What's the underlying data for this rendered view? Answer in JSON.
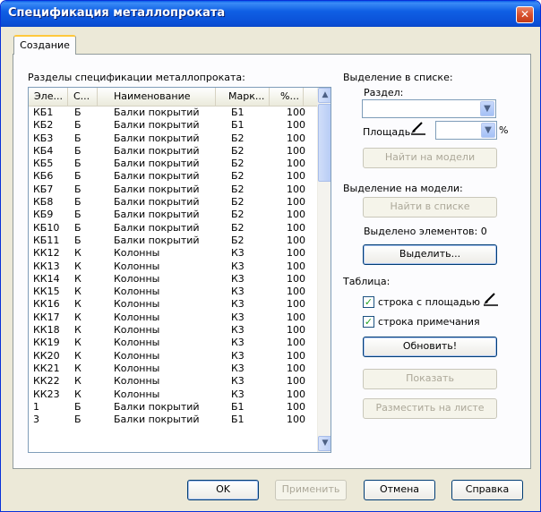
{
  "window": {
    "title": "Спецификация металлопроката",
    "close_glyph": "✕"
  },
  "tabs": [
    {
      "label": "Создание",
      "active": true
    }
  ],
  "list": {
    "label": "Разделы спецификации металлопроката:",
    "columns": [
      "Эле...",
      "С...",
      "Наименование",
      "Марк...",
      "%..."
    ],
    "rows": [
      [
        "КБ1",
        "Б",
        "Балки покрытий",
        "Б1",
        "100"
      ],
      [
        "КБ2",
        "Б",
        "Балки покрытий",
        "Б1",
        "100"
      ],
      [
        "КБ3",
        "Б",
        "Балки покрытий",
        "Б2",
        "100"
      ],
      [
        "КБ4",
        "Б",
        "Балки покрытий",
        "Б2",
        "100"
      ],
      [
        "КБ5",
        "Б",
        "Балки покрытий",
        "Б2",
        "100"
      ],
      [
        "КБ6",
        "Б",
        "Балки покрытий",
        "Б2",
        "100"
      ],
      [
        "КБ7",
        "Б",
        "Балки покрытий",
        "Б2",
        "100"
      ],
      [
        "КБ8",
        "Б",
        "Балки покрытий",
        "Б2",
        "100"
      ],
      [
        "КБ9",
        "Б",
        "Балки покрытий",
        "Б2",
        "100"
      ],
      [
        "КБ10",
        "Б",
        "Балки покрытий",
        "Б2",
        "100"
      ],
      [
        "КБ11",
        "Б",
        "Балки покрытий",
        "Б2",
        "100"
      ],
      [
        "КК12",
        "К",
        "Колонны",
        "К3",
        "100"
      ],
      [
        "КК13",
        "К",
        "Колонны",
        "К3",
        "100"
      ],
      [
        "КК14",
        "К",
        "Колонны",
        "К3",
        "100"
      ],
      [
        "КК15",
        "К",
        "Колонны",
        "К3",
        "100"
      ],
      [
        "КК16",
        "К",
        "Колонны",
        "К3",
        "100"
      ],
      [
        "КК17",
        "К",
        "Колонны",
        "К3",
        "100"
      ],
      [
        "КК18",
        "К",
        "Колонны",
        "К3",
        "100"
      ],
      [
        "КК19",
        "К",
        "Колонны",
        "К3",
        "100"
      ],
      [
        "КК20",
        "К",
        "Колонны",
        "К3",
        "100"
      ],
      [
        "КК21",
        "К",
        "Колонны",
        "К3",
        "100"
      ],
      [
        "КК22",
        "К",
        "Колонны",
        "К3",
        "100"
      ],
      [
        "КК23",
        "К",
        "Колонны",
        "К3",
        "100"
      ],
      [
        "1",
        "Б",
        "Балки покрытий",
        "Б1",
        "100"
      ],
      [
        "3",
        "Б",
        "Балки покрытий",
        "Б1",
        "100"
      ]
    ]
  },
  "selection_in_list": {
    "header": "Выделение в списке:",
    "section_label": "Раздел:",
    "section_value": "",
    "area_label": "Площадь",
    "area_value": "",
    "percent": "%",
    "find_on_model": "Найти на модели"
  },
  "selection_on_model": {
    "header": "Выделение на модели:",
    "find_in_list": "Найти в списке",
    "selected_count_text": "Выделено элементов: 0",
    "select_button": "Выделить..."
  },
  "table": {
    "header": "Таблица:",
    "row_with_area": {
      "label": "строка с площадью",
      "checked": true
    },
    "row_note": {
      "label": "строка примечания",
      "checked": true
    },
    "refresh": "Обновить!",
    "show": "Показать",
    "place_on_sheet": "Разместить на листе"
  },
  "footer": {
    "ok": "OK",
    "apply": "Применить",
    "cancel": "Отмена",
    "help": "Справка"
  },
  "icons": {
    "close": "close-icon",
    "scroll_up": "▲",
    "scroll_down": "▼",
    "combo_arrow": "▼",
    "check": "✓"
  }
}
